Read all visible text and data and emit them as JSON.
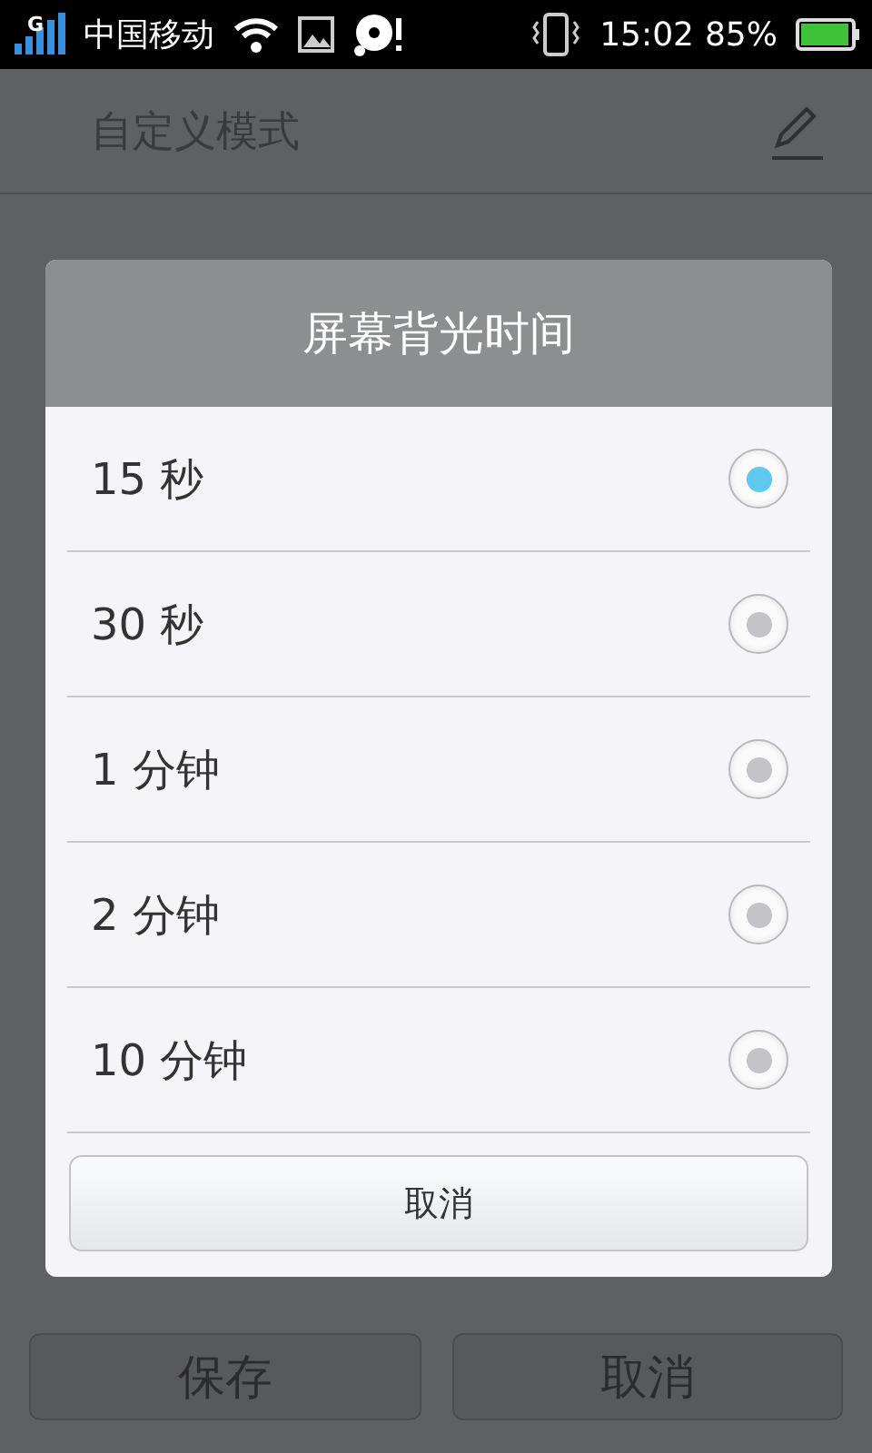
{
  "status_bar": {
    "network": "G",
    "carrier": "中国移动",
    "time": "15:02",
    "battery": "85%"
  },
  "header": {
    "title": "自定义模式"
  },
  "dialog": {
    "title": "屏幕背光时间",
    "options": [
      {
        "label": "15 秒",
        "selected": true
      },
      {
        "label": "30 秒",
        "selected": false
      },
      {
        "label": "1 分钟",
        "selected": false
      },
      {
        "label": "2 分钟",
        "selected": false
      },
      {
        "label": "10 分钟",
        "selected": false
      }
    ],
    "cancel": "取消"
  },
  "footer": {
    "buttons": [
      "保存",
      "取消"
    ]
  }
}
